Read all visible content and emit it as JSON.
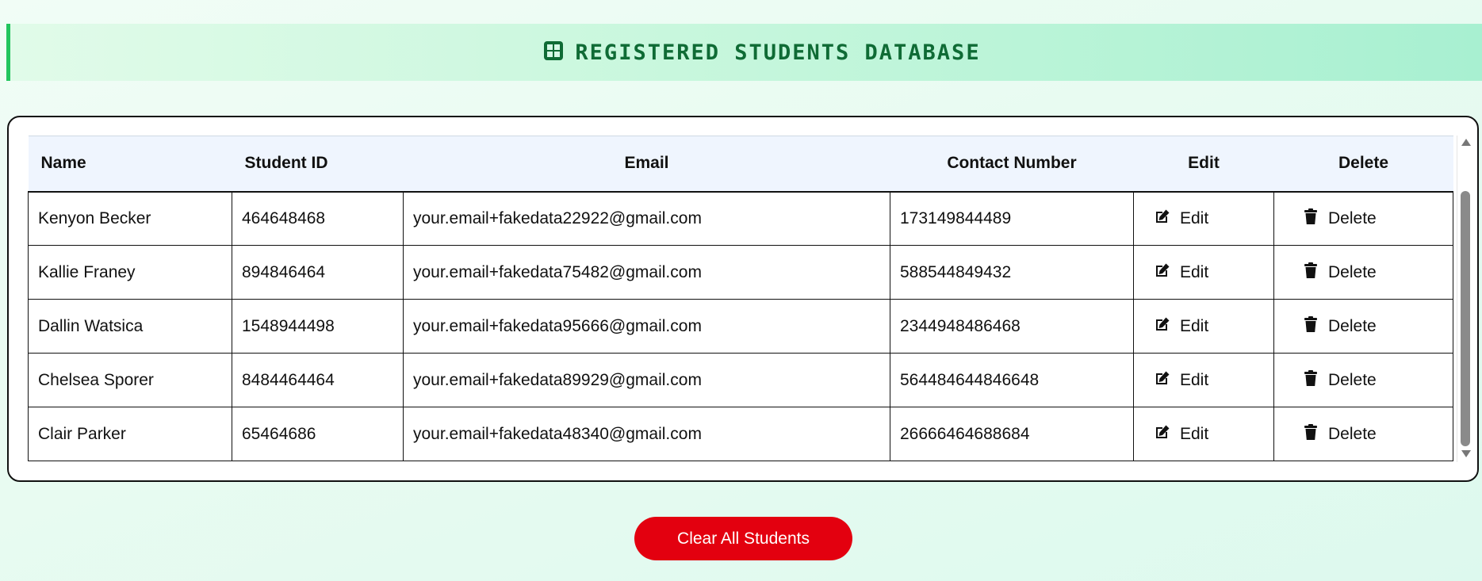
{
  "header": {
    "icon": "table-grid-icon",
    "title": "Registered Students Database"
  },
  "table": {
    "columns": [
      "Name",
      "Student ID",
      "Email",
      "Contact Number",
      "Edit",
      "Delete"
    ],
    "rows": [
      {
        "name": "Kenyon Becker",
        "student_id": "464648468",
        "email": "your.email+fakedata22922@gmail.com",
        "contact": "173149844489",
        "edit_label": "Edit",
        "delete_label": "Delete"
      },
      {
        "name": "Kallie Franey",
        "student_id": "894846464",
        "email": "your.email+fakedata75482@gmail.com",
        "contact": "588544849432",
        "edit_label": "Edit",
        "delete_label": "Delete"
      },
      {
        "name": "Dallin Watsica",
        "student_id": "1548944498",
        "email": "your.email+fakedata95666@gmail.com",
        "contact": "2344948486468",
        "edit_label": "Edit",
        "delete_label": "Delete"
      },
      {
        "name": "Chelsea Sporer",
        "student_id": "8484464464",
        "email": "your.email+fakedata89929@gmail.com",
        "contact": "564484644846648",
        "edit_label": "Edit",
        "delete_label": "Delete"
      },
      {
        "name": "Clair Parker",
        "student_id": "65464686",
        "email": "your.email+fakedata48340@gmail.com",
        "contact": "26666464688684",
        "edit_label": "Edit",
        "delete_label": "Delete"
      }
    ]
  },
  "actions": {
    "clear_all_label": "Clear All Students"
  },
  "colors": {
    "accent": "#22c55e",
    "title": "#0f6b35",
    "danger": "#e3000f",
    "table_header_bg": "#eff5fe"
  }
}
